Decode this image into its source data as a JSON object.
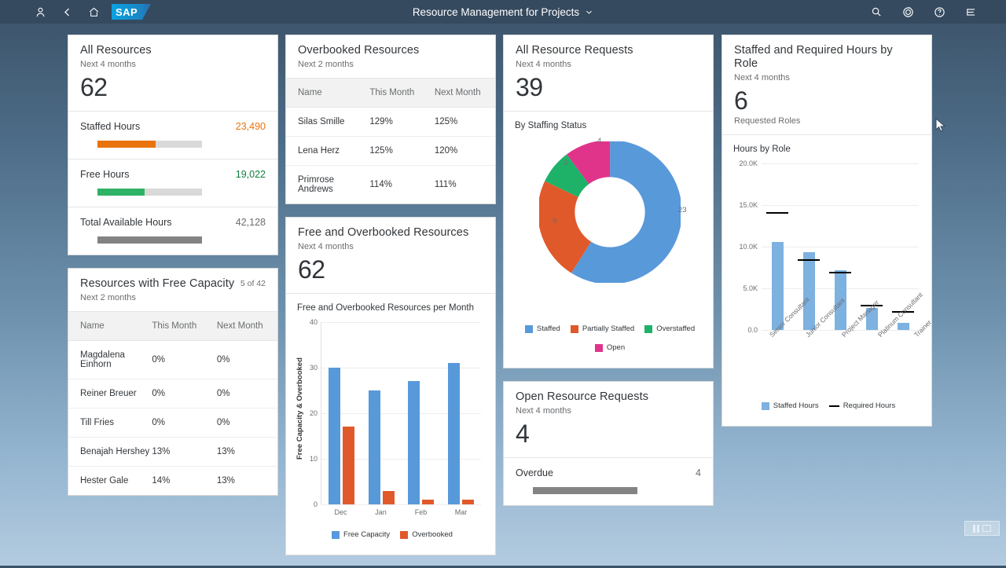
{
  "shell": {
    "title": "Resource Management for Projects",
    "logo_text": "SAP",
    "icons": {
      "user": "user-icon",
      "back": "back-chevron-icon",
      "home": "home-icon",
      "search": "search-icon",
      "copilot": "copilot-icon",
      "help": "help-icon",
      "menu": "menu-icon",
      "title_chevron": "chevron-down-icon"
    }
  },
  "cards": {
    "all_resources": {
      "title": "All Resources",
      "subtitle": "Next 4 months",
      "kpi": "62",
      "rows": [
        {
          "label": "Staffed Hours",
          "value": "23,490",
          "color": "#e9730c",
          "percent": 56
        },
        {
          "label": "Free Hours",
          "value": "19,022",
          "color": "#2eb265",
          "percent": 45
        },
        {
          "label": "Total Available Hours",
          "value": "42,128",
          "color": "#838383",
          "percent": 100
        }
      ]
    },
    "free_capacity": {
      "title": "Resources with Free Capacity",
      "subtitle": "Next 2 months",
      "count": "5 of 42",
      "columns": [
        "Name",
        "This Month",
        "Next Month"
      ],
      "rows": [
        [
          "Magdalena Einhorn",
          "0%",
          "0%"
        ],
        [
          "Reiner Breuer",
          "0%",
          "0%"
        ],
        [
          "Till Fries",
          "0%",
          "0%"
        ],
        [
          "Benajah Hershey",
          "13%",
          "13%"
        ],
        [
          "Hester Gale",
          "14%",
          "13%"
        ]
      ]
    },
    "overbooked": {
      "title": "Overbooked Resources",
      "subtitle": "Next 2 months",
      "columns": [
        "Name",
        "This Month",
        "Next Month"
      ],
      "rows": [
        [
          "Silas Smille",
          "129%",
          "125%"
        ],
        [
          "Lena Herz",
          "125%",
          "120%"
        ],
        [
          "Primrose Andrews",
          "114%",
          "111%"
        ]
      ]
    },
    "free_overbooked": {
      "title": "Free and Overbooked Resources",
      "subtitle": "Next 4 months",
      "kpi": "62",
      "chart_title": "Free and Overbooked Resources per Month"
    },
    "all_requests": {
      "title": "All Resource Requests",
      "subtitle": "Next 4 months",
      "kpi": "39",
      "chart_title": "By Staffing Status"
    },
    "open_requests": {
      "title": "Open Resource Requests",
      "subtitle": "Next 4 months",
      "kpi": "4",
      "rows": [
        {
          "label": "Overdue",
          "value": "4",
          "color": "#838383",
          "percent": 100
        }
      ]
    },
    "hours_by_role": {
      "title": "Staffed and Required Hours by Role",
      "subtitle": "Next 4 months",
      "kpi": "6",
      "kpi_unit": "Requested Roles",
      "chart_title": "Hours by Role"
    }
  },
  "chart_data": [
    {
      "id": "free_overbooked_per_month",
      "type": "bar",
      "title": "Free and Overbooked Resources per Month",
      "xlabel": "",
      "ylabel": "Free Capacity & Overbooked",
      "categories": [
        "Dec",
        "Jan",
        "Feb",
        "Mar"
      ],
      "yticks": [
        "0",
        "10",
        "20",
        "30",
        "40"
      ],
      "ylim": [
        0,
        40
      ],
      "grid": true,
      "legend_position": "bottom",
      "series": [
        {
          "name": "Free Capacity",
          "color": "#5899da",
          "values": [
            30,
            25,
            27,
            31
          ]
        },
        {
          "name": "Overbooked",
          "color": "#e0592a",
          "values": [
            17,
            3,
            1,
            1
          ]
        }
      ]
    },
    {
      "id": "requests_by_staffing_status",
      "type": "pie",
      "title": "By Staffing Status",
      "legend_position": "bottom",
      "total": 39,
      "labels": [
        "Staffed",
        "Partially Staffed",
        "Overstaffed",
        "Open"
      ],
      "values": [
        23,
        9,
        3,
        4
      ],
      "colors": [
        "#5899da",
        "#e0592a",
        "#1eb268",
        "#e0348b"
      ]
    },
    {
      "id": "hours_by_role",
      "type": "bar",
      "title": "Hours by Role",
      "xlabel": "",
      "ylabel": "",
      "categories": [
        "Senior Consultant",
        "Junior Consultant",
        "Project Manager",
        "Platinum Consultant",
        "Trainer"
      ],
      "yticks": [
        "0.0",
        "5.0K",
        "10.0K",
        "15.0K",
        "20.0K"
      ],
      "ylim": [
        0,
        20000
      ],
      "grid": true,
      "legend_position": "bottom",
      "series": [
        {
          "name": "Staffed Hours",
          "color": "#7db1e0",
          "type": "bar",
          "values": [
            10600,
            9300,
            7200,
            2600,
            800
          ]
        },
        {
          "name": "Required Hours",
          "color": "#000000",
          "type": "marker",
          "values": [
            14000,
            8300,
            6800,
            2800,
            2100
          ]
        }
      ]
    }
  ]
}
